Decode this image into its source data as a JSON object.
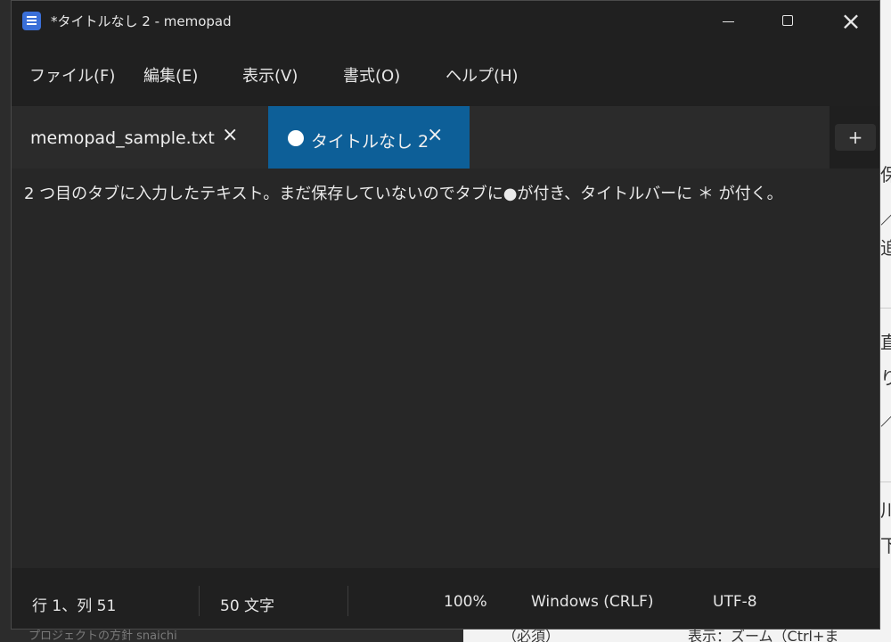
{
  "window": {
    "title": "*タイトルなし 2 - memopad",
    "controls": {
      "minimize": "minimize",
      "maximize": "maximize",
      "close": "×"
    }
  },
  "menu": [
    {
      "label": "ファイル(F)"
    },
    {
      "label": "編集(E)"
    },
    {
      "label": "表示(V)"
    },
    {
      "label": "書式(O)"
    },
    {
      "label": "ヘルプ(H)"
    }
  ],
  "tabs": [
    {
      "label": "memopad_sample.txt",
      "close": "×",
      "active": false,
      "modified": false
    },
    {
      "label": "タイトルなし 2",
      "close": "×",
      "active": true,
      "modified": true
    }
  ],
  "new_tab_label": "+",
  "editor": {
    "content": "2  つ目のタブに入力したテキスト。まだ保存していないのでタブに●が付き、タイトルバーに  ＊  が付く。"
  },
  "status": {
    "position": "行 1、列 51",
    "char_count": "50 文字",
    "zoom": "100%",
    "line_ending": "Windows (CRLF)",
    "encoding": "UTF-8"
  },
  "colors": {
    "active_tab": "#0d5f98",
    "window_bg": "#272727",
    "title_bg": "#202020",
    "app_icon": "#3a6fd8"
  },
  "icons": {
    "app": "notepad-icon",
    "modified": "dot-icon",
    "tab_close": "close-icon",
    "new_tab": "plus-icon"
  }
}
